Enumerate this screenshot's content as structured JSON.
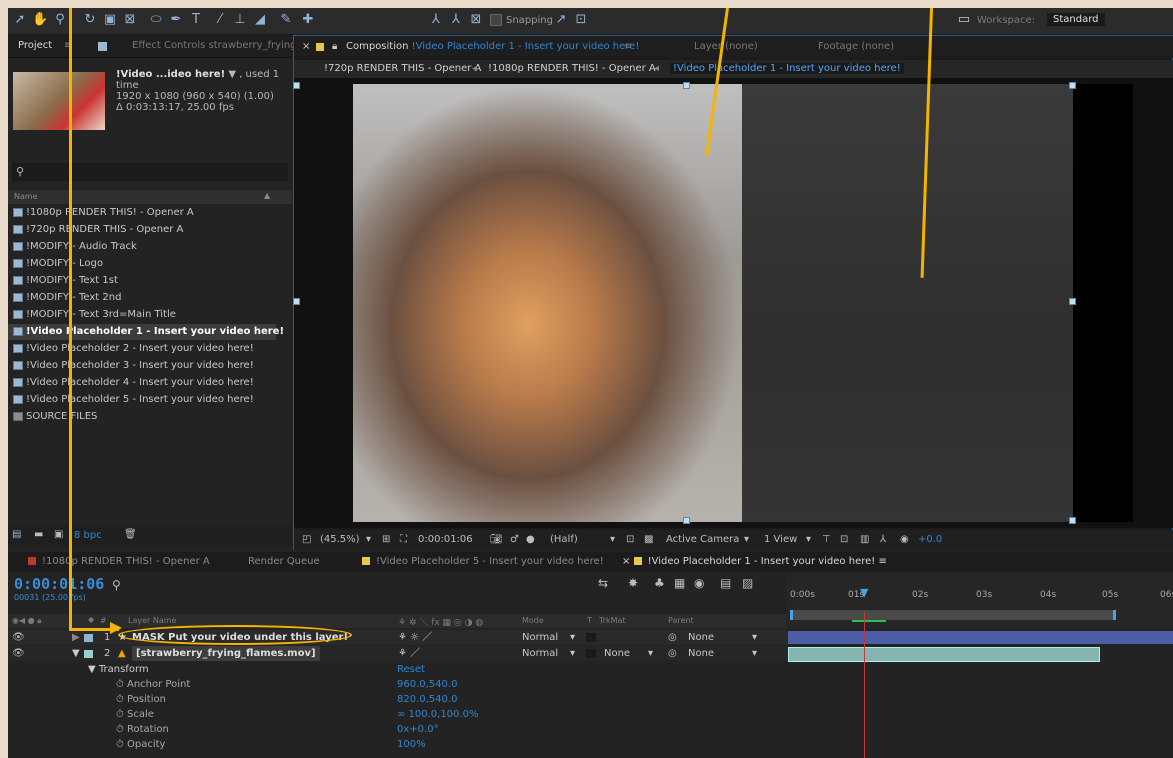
{
  "toolbar": {
    "snapping": "Snapping",
    "workspace_label": "Workspace:",
    "workspace_value": "Standard"
  },
  "project": {
    "tabs": [
      "Project",
      "Effect Controls strawberry_frying_"
    ],
    "selected": {
      "name": "!Video ...ideo here!",
      "used": "▼ , used 1 time",
      "dims": "1920 x 1080  (960 x 540) (1.00)",
      "duration": "Δ 0:03:13:17, 25.00 fps"
    },
    "name_header": "Name",
    "items": [
      "!1080p RENDER THIS! - Opener A",
      "!720p RENDER THIS - Opener A",
      "!MODIFY - Audio Track",
      "!MODIFY - Logo",
      "!MODIFY - Text 1st",
      "!MODIFY - Text 2nd",
      "!MODIFY - Text 3rd=Main Title",
      "!Video Placeholder 1 - Insert your video here!",
      "!Video Placeholder 2 - Insert your video here!",
      "!Video Placeholder 3 - Insert your video here!",
      "!Video Placeholder 4 - Insert your video here!",
      "!Video Placeholder 5 - Insert your video here!",
      "SOURCE FILES"
    ],
    "bpc": "8 bpc"
  },
  "comp": {
    "tab_title": "Composition",
    "tab_name": "!Video Placeholder 1 - Insert your video here!",
    "layer_tab": "Layer (none)",
    "footage_tab": "Footage (none)",
    "flow": [
      "!720p RENDER THIS - Opener A",
      "!1080p RENDER THIS! - Opener A",
      "!Video Placeholder 1 - Insert your video here!"
    ],
    "footer": {
      "zoom": "(45.5%)",
      "time": "0:00:01:06",
      "res": "(Half)",
      "camera": "Active Camera",
      "view": "1 View",
      "exposure": "+0.0"
    }
  },
  "timeline": {
    "tabs": [
      "!1080p RENDER THIS! - Opener A",
      "Render Queue",
      "!Video Placeholder 5 - Insert your video here!",
      "!Video Placeholder 1 - Insert your video here!"
    ],
    "timecode": "0:00:01:06",
    "fps": "00031 (25.00 fps)",
    "columns": {
      "num": "#",
      "layer_name": "Layer Name",
      "mode": "Mode",
      "t": "T",
      "trkmat": "TrkMat",
      "parent": "Parent"
    },
    "ruler": [
      "0:00s",
      "01s",
      "02s",
      "03s",
      "04s",
      "05s",
      "06s"
    ],
    "layers": [
      {
        "num": "1",
        "name": "MASK Put your video under this layer!",
        "mode": "Normal",
        "trkmat": "",
        "parent": "None"
      },
      {
        "num": "2",
        "name": "[strawberry_frying_flames.mov]",
        "mode": "Normal",
        "trkmat": "None",
        "parent": "None"
      }
    ],
    "transform": {
      "label": "Transform",
      "reset": "Reset",
      "props": [
        {
          "name": "Anchor Point",
          "value": "960.0,540.0"
        },
        {
          "name": "Position",
          "value": "820.0,540.0"
        },
        {
          "name": "Scale",
          "value": "∞ 100.0,100.0%"
        },
        {
          "name": "Rotation",
          "value": "0x+0.0°"
        },
        {
          "name": "Opacity",
          "value": "100%"
        }
      ]
    }
  },
  "colors": {
    "accent": "#2f86d0",
    "annotation": "#f5b400",
    "playhead": "#c23b3b"
  }
}
